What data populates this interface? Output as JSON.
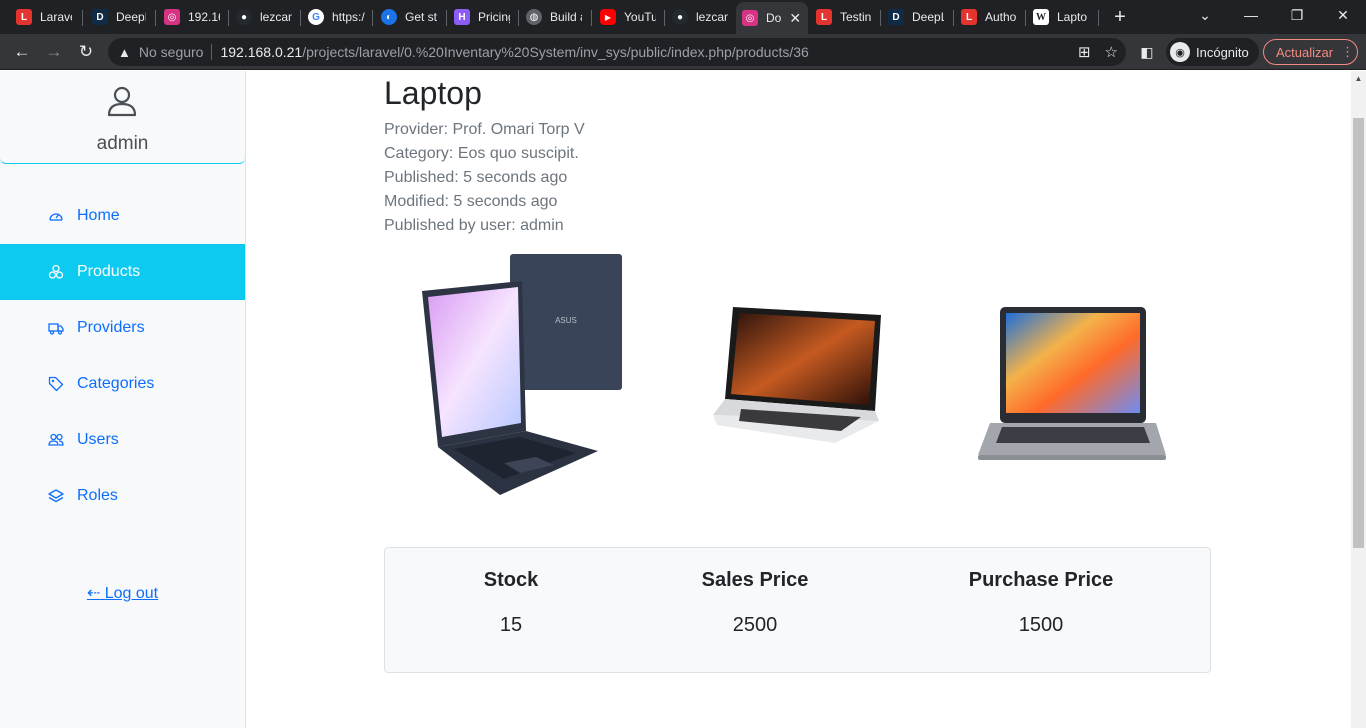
{
  "browser": {
    "tabs": [
      {
        "title": "Larave",
        "icon": "laravel-icon",
        "color": "#e3342f"
      },
      {
        "title": "DeepL",
        "icon": "deepl-icon",
        "color": "#0f2b46"
      },
      {
        "title": "192.16",
        "icon": "app-icon",
        "color": "#d63384"
      },
      {
        "title": "lezcan",
        "icon": "github-icon",
        "color": "#24292f"
      },
      {
        "title": "https:/",
        "icon": "google-icon",
        "color": "#4285f4"
      },
      {
        "title": "Get st",
        "icon": "cloud-icon",
        "color": "#1a73e8"
      },
      {
        "title": "Pricing",
        "icon": "heroku-icon",
        "color": "#8b5cf6"
      },
      {
        "title": "Build a",
        "icon": "globe-icon",
        "color": "#5f6368"
      },
      {
        "title": "YouTu",
        "icon": "youtube-icon",
        "color": "#ff0000"
      },
      {
        "title": "lezcan",
        "icon": "github-icon",
        "color": "#24292f"
      },
      {
        "title": "Do",
        "icon": "app-icon",
        "color": "#d63384"
      },
      {
        "title": "Testin",
        "icon": "laravel-icon",
        "color": "#e3342f"
      },
      {
        "title": "DeepL",
        "icon": "deepl-icon",
        "color": "#0f2b46"
      },
      {
        "title": "Autho",
        "icon": "laravel-icon",
        "color": "#e3342f"
      },
      {
        "title": "Lapto",
        "icon": "wikipedia-icon",
        "color": "#ffffff"
      }
    ],
    "not_secure": "No seguro",
    "url_host": "192.168.0.21",
    "url_path": "/projects/laravel/0.%20Inventary%20System/inv_sys/public/index.php/products/36",
    "incognito_label": "Incógnito",
    "update_label": "Actualizar"
  },
  "sidebar": {
    "user": "admin",
    "items": [
      {
        "label": "Home",
        "icon": "speedometer-icon",
        "active": false
      },
      {
        "label": "Products",
        "icon": "boxes-icon",
        "active": true
      },
      {
        "label": "Providers",
        "icon": "truck-icon",
        "active": false
      },
      {
        "label": "Categories",
        "icon": "tag-icon",
        "active": false
      },
      {
        "label": "Users",
        "icon": "people-icon",
        "active": false
      },
      {
        "label": "Roles",
        "icon": "layers-icon",
        "active": false
      }
    ],
    "logout": "Log out"
  },
  "product": {
    "title": "Laptop",
    "provider": "Provider: Prof. Omari Torp V",
    "category": "Category: Eos quo suscipit.",
    "published": "Published: 5 seconds ago",
    "modified": "Modified: 5 seconds ago",
    "published_by": "Published by user: admin",
    "stats": {
      "stock_label": "Stock",
      "stock_value": "15",
      "sales_label": "Sales Price",
      "sales_value": "2500",
      "purchase_label": "Purchase Price",
      "purchase_value": "1500"
    }
  }
}
